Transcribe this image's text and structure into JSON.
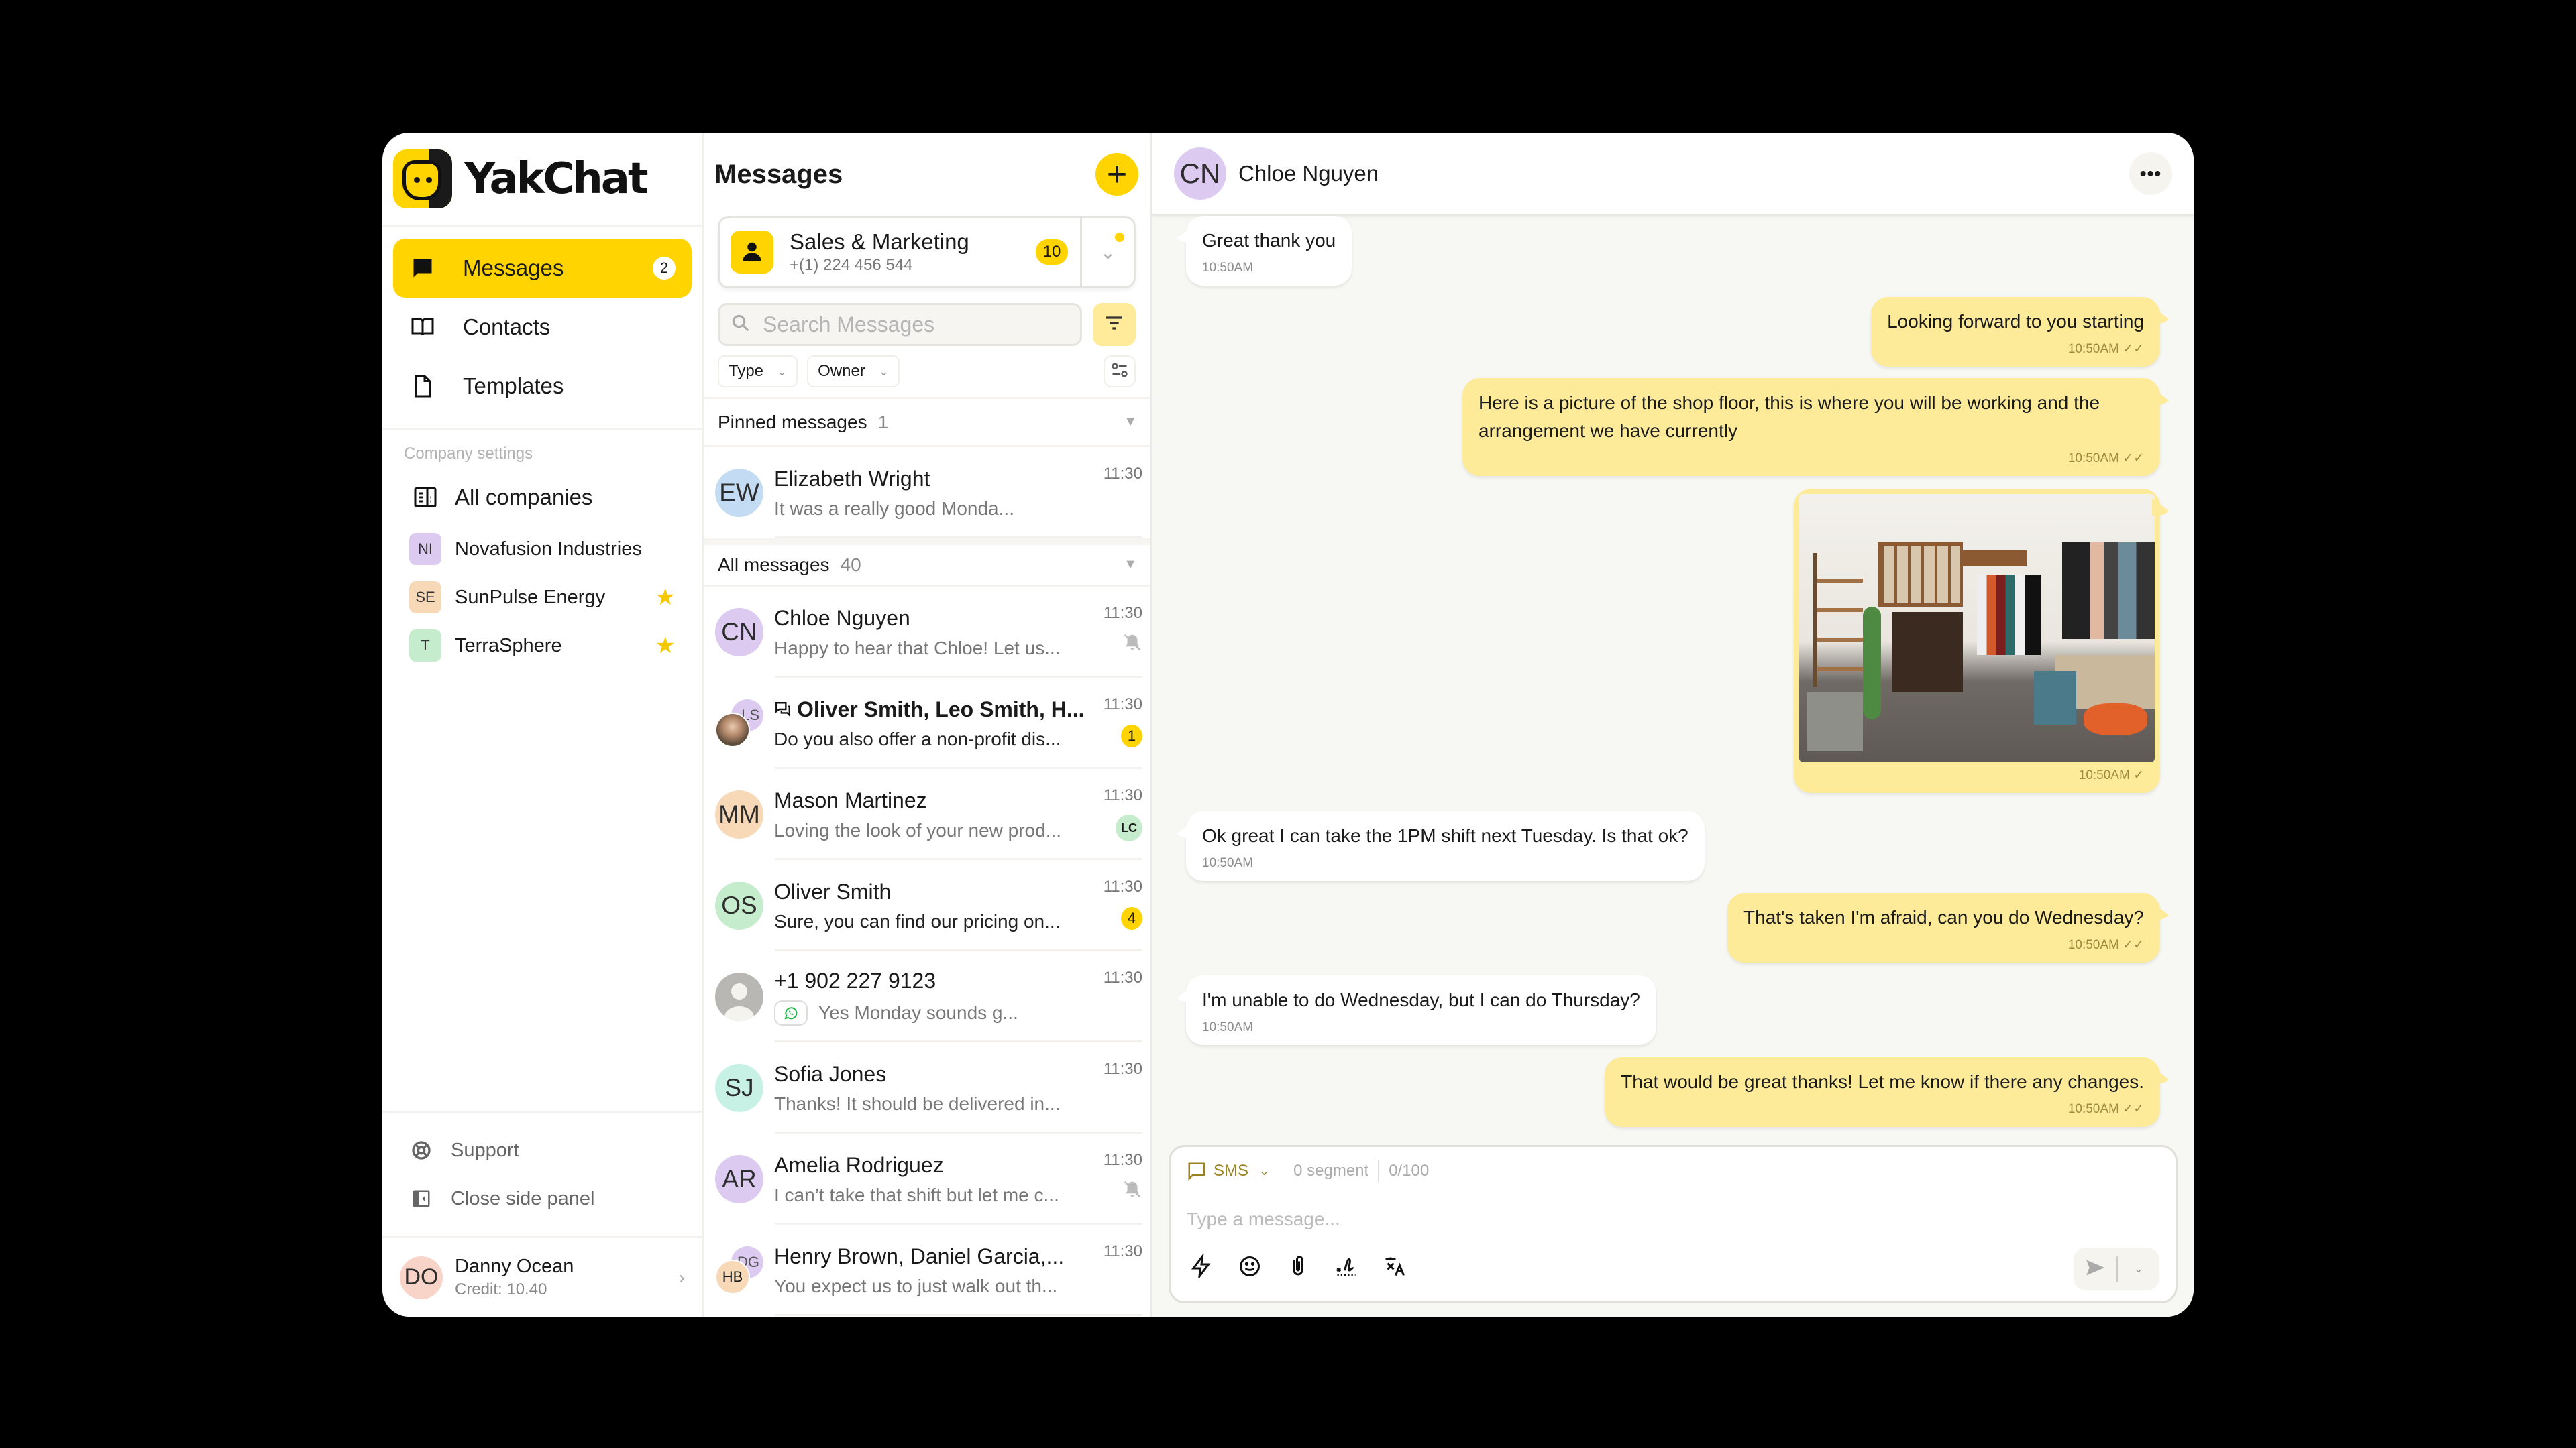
{
  "app": {
    "name": "YakChat"
  },
  "sidebar": {
    "nav": [
      {
        "label": "Messages",
        "icon": "chat-bubble-icon",
        "badge": "2",
        "active": true
      },
      {
        "label": "Contacts",
        "icon": "book-icon"
      },
      {
        "label": "Templates",
        "icon": "document-icon"
      }
    ],
    "company_section_label": "Company settings",
    "all_companies_label": "All companies",
    "companies": [
      {
        "initials": "NI",
        "name": "Novafusion Industries",
        "color": "#dccaf1",
        "starred": false
      },
      {
        "initials": "SE",
        "name": "SunPulse Energy",
        "color": "#f8d9b7",
        "starred": true
      },
      {
        "initials": "T",
        "name": "TerraSphere",
        "color": "#c6ecce",
        "starred": true
      }
    ],
    "support_label": "Support",
    "close_panel_label": "Close side panel",
    "user": {
      "initials": "DO",
      "name": "Danny Ocean",
      "credit": "Credit: 10.40"
    }
  },
  "list": {
    "title": "Messages",
    "inbox": {
      "name": "Sales  & Marketing",
      "phone": "+(1) 224 456 544",
      "count": "10"
    },
    "search_placeholder": "Search Messages",
    "filters": [
      "Type",
      "Owner"
    ],
    "pinned": {
      "label": "Pinned messages",
      "count": "1"
    },
    "all": {
      "label": "All messages",
      "count": "40"
    },
    "pinned_items": [
      {
        "initials": "EW",
        "color": "#c4dcf3",
        "name": "Elizabeth Wright",
        "preview": "It was a really good Monda...",
        "time": "11:30"
      }
    ],
    "items": [
      {
        "initials": "CN",
        "color": "#dccaf1",
        "name": "Chloe Nguyen",
        "preview": "Happy to hear that Chloe! Let us...",
        "time": "11:30",
        "muted": true
      },
      {
        "group": true,
        "back_initials": "LS",
        "back_color": "#dccaf1",
        "name": "Oliver Smith, Leo Smith, H...",
        "preview": "Do you also offer a non-profit dis...",
        "time": "11:30",
        "unread": "1"
      },
      {
        "initials": "MM",
        "color": "#f8d9b7",
        "name": "Mason Martinez",
        "preview": "Loving the look of your new prod...",
        "time": "11:30",
        "owner": "LC"
      },
      {
        "initials": "OS",
        "color": "#c6ecce",
        "name": "Oliver Smith",
        "preview": "Sure, you can find our pricing on...",
        "time": "11:30",
        "unread": "4"
      },
      {
        "unknown": true,
        "name": "+1 902 227 9123",
        "preview": "Yes Monday sounds g...",
        "time": "11:30",
        "channel": "whatsapp"
      },
      {
        "initials": "SJ",
        "color": "#c8f1e6",
        "name": "Sofia Jones",
        "preview": "Thanks! It should be delivered in...",
        "time": "11:30"
      },
      {
        "initials": "AR",
        "color": "#dccaf1",
        "name": "Amelia Rodriguez",
        "preview": "I can’t take that shift but let me c...",
        "time": "11:30",
        "muted": true
      },
      {
        "group": true,
        "back_initials": "DG",
        "back_color": "#dccaf1",
        "front_initials": "HB",
        "front_color": "#f8d9b7",
        "name": "Henry Brown, Daniel Garcia,...",
        "preview": "You expect us to just walk out th...",
        "time": "11:30"
      }
    ]
  },
  "chat": {
    "contact": {
      "initials": "CN",
      "name": "Chloe Nguyen"
    },
    "messages": [
      {
        "dir": "in",
        "text": "Great thank you",
        "time": "10:50AM"
      },
      {
        "dir": "out",
        "text": "Looking forward to you starting",
        "time": "10:50AM",
        "status": "read"
      },
      {
        "dir": "out",
        "text": "Here is a picture of the shop floor, this is where you will be working and the arrangement we have currently",
        "time": "10:50AM",
        "status": "read"
      },
      {
        "dir": "out",
        "image": "shop-floor-photo",
        "time": "10:50AM",
        "status": "sent"
      },
      {
        "dir": "in",
        "text": "Ok great I can take the 1PM shift next Tuesday. Is that ok?",
        "time": "10:50AM"
      },
      {
        "dir": "out",
        "text": "That's taken I'm afraid, can you do Wednesday?",
        "time": "10:50AM",
        "status": "read"
      },
      {
        "dir": "in",
        "text": "I'm unable to do Wednesday, but I can do Thursday?",
        "time": "10:50AM"
      },
      {
        "dir": "out",
        "text": "That would be great thanks! Let me know if there any changes.",
        "time": "10:50AM",
        "status": "read"
      }
    ],
    "composer": {
      "channel": "SMS",
      "segments": "0 segment",
      "chars": "0/100",
      "placeholder": "Type a message...",
      "value": ""
    }
  },
  "colors": {
    "accent": "#ffd400",
    "outgoing": "#feeb99",
    "chat_bg": "#f7f7f3"
  }
}
